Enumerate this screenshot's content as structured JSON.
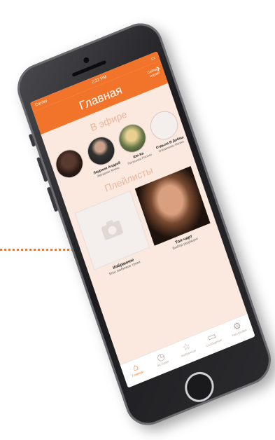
{
  "colors": {
    "accent": "#f2742a",
    "screen_bg": "#fbe9df",
    "callout": "#f07a2a"
  },
  "status_bar": {
    "carrier": "Carrier",
    "time": "2:22 PM"
  },
  "nav": {
    "title": "Главная",
    "right_label": "Сейчас играет"
  },
  "live": {
    "title": "В эфире",
    "items": [
      {
        "name": "",
        "sub": ""
      },
      {
        "name": "Лаурини Андрей",
        "sub": "Звёздная Жизнь"
      },
      {
        "name": "Ши-Ка",
        "sub": "Погасшая Россия"
      },
      {
        "name": "Отдыха В Добаш",
        "sub": "Отражения Жизни"
      }
    ]
  },
  "playlists": {
    "title": "Плейлисты",
    "items": [
      {
        "title": "Избранное",
        "sub": "Мои любимые треки"
      },
      {
        "title": "Топ-чарт",
        "sub": "Выбор редакции"
      }
    ]
  },
  "tabs": [
    {
      "label": "Главная",
      "icon": "home-icon"
    },
    {
      "label": "История",
      "icon": "clock-icon"
    },
    {
      "label": "Избранное",
      "icon": "star-icon"
    },
    {
      "label": "Сообщения",
      "icon": "message-icon"
    },
    {
      "label": "Настройки",
      "icon": "gear-icon"
    }
  ]
}
